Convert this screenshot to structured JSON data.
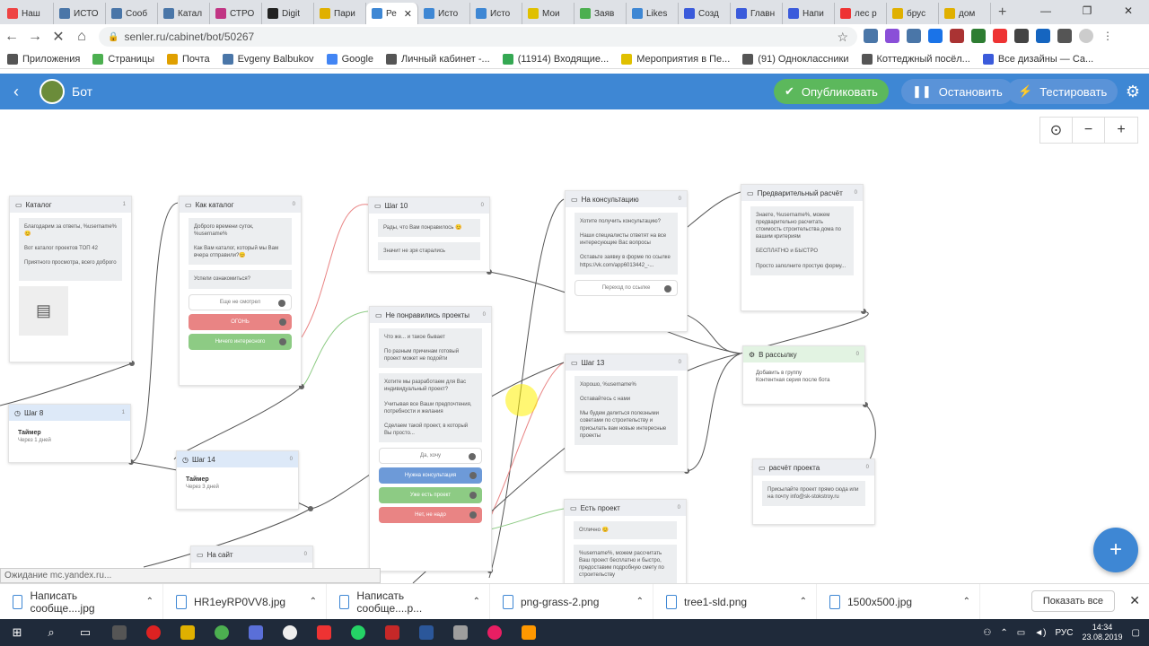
{
  "browser": {
    "tabs": [
      {
        "label": "Наш",
        "color": "#e44"
      },
      {
        "label": "ИСТО",
        "color": "#4a76a8"
      },
      {
        "label": "Сооб",
        "color": "#4a76a8"
      },
      {
        "label": "Катал",
        "color": "#4a76a8"
      },
      {
        "label": "СТРО",
        "color": "#c13584"
      },
      {
        "label": "Digit",
        "color": "#222"
      },
      {
        "label": "Пари",
        "color": "#e0b000"
      },
      {
        "label": "Ре",
        "color": "#3e87d4",
        "active": true
      },
      {
        "label": "Исто",
        "color": "#3e87d4"
      },
      {
        "label": "Исто",
        "color": "#3e87d4"
      },
      {
        "label": "Мои",
        "color": "#e0c000"
      },
      {
        "label": "Заяв",
        "color": "#4caf50"
      },
      {
        "label": "Likes",
        "color": "#3e87d4"
      },
      {
        "label": "Созд",
        "color": "#3b5bdb"
      },
      {
        "label": "Главн",
        "color": "#3b5bdb"
      },
      {
        "label": "Напи",
        "color": "#3b5bdb"
      },
      {
        "label": "лес р",
        "color": "#e33"
      },
      {
        "label": "брус",
        "color": "#e0b000"
      },
      {
        "label": "дом",
        "color": "#e0b000"
      }
    ],
    "url": "senler.ru/cabinet/bot/50267",
    "bookmarks": [
      {
        "label": "Приложения",
        "color": "#555"
      },
      {
        "label": "Страницы",
        "color": "#4caf50"
      },
      {
        "label": "Почта",
        "color": "#e0a000"
      },
      {
        "label": "Evgeny Balbukov",
        "color": "#4a76a8"
      },
      {
        "label": "Google",
        "color": "#4285f4"
      },
      {
        "label": "Личный кабинет -...",
        "color": "#555"
      },
      {
        "label": "(11914) Входящие...",
        "color": "#34a853"
      },
      {
        "label": "(11914) Входящие...",
        "color": "#555"
      },
      {
        "label": "Мероприятия в Пе...",
        "color": "#e0c000"
      },
      {
        "label": "(91) Одноклассники",
        "color": "#555"
      },
      {
        "label": "Коттеджный посёл...",
        "color": "#555"
      },
      {
        "label": "Все дизайны — Са...",
        "color": "#3b5bdb"
      }
    ]
  },
  "app": {
    "title": "Бот",
    "publish": "Опубликовать",
    "stop": "Остановить",
    "test": "Тестировать"
  },
  "nodes": {
    "catalog": {
      "title": "Каталог",
      "count": "1",
      "msg": "Благодарим за ответы, %username%😊\n\nВот каталог проектов ТОП 42\n\nПриятного просмотра, всего доброго"
    },
    "how_catalog": {
      "title": "Как каталог",
      "count": "0",
      "msg1": "Доброго времени суток, %username%\n\nКак Вам каталог, который мы Вам вчера отправили?😊",
      "msg2": "Успели ознакомиться?",
      "b1": "Еще не смотрел",
      "b2": "ОГОНЬ",
      "b3": "Ничего интересного"
    },
    "step10": {
      "title": "Шаг 10",
      "count": "0",
      "msg1": "Рады, что Вам понравилось 😊",
      "msg2": "Значит не зря старались"
    },
    "consult": {
      "title": "На консультацию",
      "count": "0",
      "msg": "Хотите получить консультацию?\n\nНаши специалисты ответят на все интересующие Вас вопросы\n\nОставьте заявку в форме по ссылке\nhttps://vk.com/app6013442_-...",
      "b1": "Переход по ссылке"
    },
    "prelim": {
      "title": "Предварительный расчёт",
      "count": "0",
      "msg": "Знаете, %username%, можем предварительно расчитать стоимость строительства дома по вашим критериям\n\nБЕСПЛАТНО и БЫСТРО\n\nПросто заполните простую форму..."
    },
    "notliked": {
      "title": "Не понравились проекты",
      "count": "0",
      "msg1": "Что же... и такое бывает\n\nПо разным причинам готовый проект может не подойти",
      "msg2": "Хотите мы разработаем для Вас индивидуальный проект?\n\nУчитывая все Ваши предпочтения, потребности и желания\n\nСделаем такой проект, в который Вы просто...",
      "b1": "Да, хочу",
      "b2": "Нужна консультация",
      "b3": "Уже есть проект",
      "b4": "Нет, не надо"
    },
    "mailing": {
      "title": "В рассылку",
      "count": "0",
      "msg": "Добавить в группу\nКонтентная серия после бота"
    },
    "step13": {
      "title": "Шаг 13",
      "count": "0",
      "msg": "Хорошо, %username%\n\nОставайтесь с нами\n\nМы будем делиться полезными советами по строительству и присылать вам новые интересные проекты"
    },
    "step8": {
      "title": "Шаг 8",
      "count": "1",
      "t": "Таймер",
      "sub": "Через 1 дней"
    },
    "step14": {
      "title": "Шаг 14",
      "count": "0",
      "t": "Таймер",
      "sub": "Через 3 дней"
    },
    "calc": {
      "title": "расчёт проекта",
      "count": "0",
      "msg": "Присылайте проект прямо сюда или на почту info@sk-stokstroy.ru"
    },
    "hasproject": {
      "title": "Есть проект",
      "count": "0",
      "msg1": "Отлично 😊",
      "msg2": "%username%, можем рассчитать Ваш проект бесплатно и быстро, предоставим подробную смету по строительству"
    },
    "website": {
      "title": "На сайт",
      "count": "0"
    }
  },
  "status": "Ожидание mc.yandex.ru...",
  "downloads": [
    "Написать сообще....jpg",
    "HR1eyRP0VV8.jpg",
    "Написать сообще....p...",
    "png-grass-2.png",
    "tree1-sld.png",
    "1500x500.jpg"
  ],
  "show_all": "Показать все",
  "taskbar": {
    "lang": "РУС",
    "time": "14:34",
    "date": "23.08.2019"
  }
}
